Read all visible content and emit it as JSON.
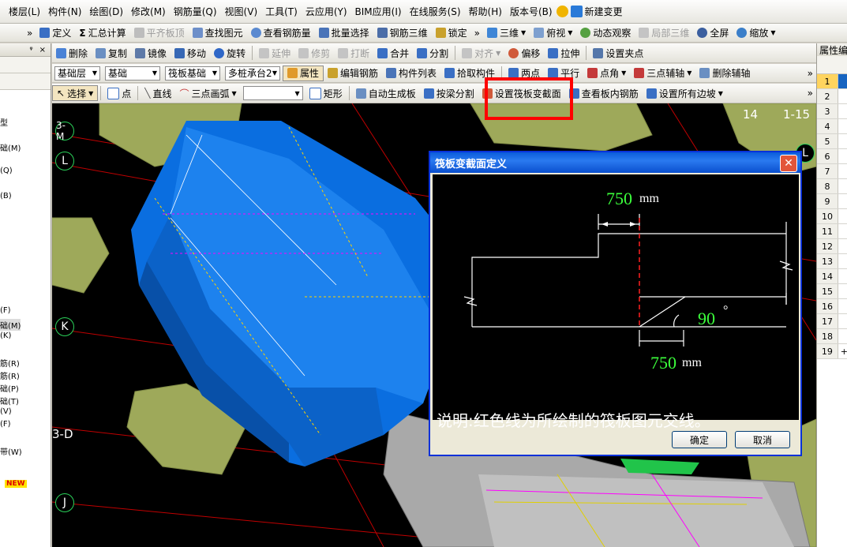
{
  "menu": [
    "楼层(L)",
    "构件(N)",
    "绘图(D)",
    "修改(M)",
    "钢筋量(Q)",
    "视图(V)",
    "工具(T)",
    "云应用(Y)",
    "BIM应用(I)",
    "在线服务(S)",
    "帮助(H)",
    "版本号(B)",
    "新建变更"
  ],
  "toolbar1": {
    "define": "定义",
    "sum": "汇总计算",
    "flush": "平齐板顶",
    "find": "查找图元",
    "view_rebar": "查看钢筋量",
    "batch_select": "批量选择",
    "rebar_3d": "钢筋三维",
    "lock": "锁定",
    "three_d": "三维",
    "top_view": "俯视",
    "dynamic": "动态观察",
    "partial_3d": "局部三维",
    "fullscreen": "全屏",
    "zoom": "缩放"
  },
  "toolbar2": {
    "delete": "删除",
    "copy": "复制",
    "mirror": "镜像",
    "move": "移动",
    "rotate": "旋转",
    "extend": "延伸",
    "trim": "修剪",
    "break": "打断",
    "merge": "合并",
    "split": "分割",
    "align": "对齐",
    "offset": "偏移",
    "stretch": "拉伸",
    "set_grip": "设置夹点"
  },
  "toolbar3": {
    "layer": "基础层",
    "category": "基础",
    "type": "筏板基础",
    "member": "多桩承台2",
    "property": "属性",
    "edit_rebar": "编辑钢筋",
    "member_list": "构件列表",
    "pick": "拾取构件",
    "two_points": "两点",
    "parallel": "平行",
    "point_angle": "点角",
    "three_point_aux": "三点辅轴",
    "delete_aux": "删除辅轴"
  },
  "toolbar4": {
    "select": "选择",
    "point": "点",
    "line": "直线",
    "arc": "三点画弧",
    "rect": "矩形",
    "auto_gen": "自动生成板",
    "split_by_beam": "按梁分割",
    "set_variable": "设置筏板变截面",
    "view_rebar_in_slab": "查看板内钢筋",
    "set_all_slope": "设置所有边坡"
  },
  "left_panel": {
    "items": [
      "型",
      "础(M)",
      "(Q)",
      "(B)",
      "(F)",
      "础(M)",
      "(K)",
      "筋(R)",
      "筋(R)",
      "础(P)",
      "础(T)",
      "(V)",
      "(F)",
      "带(W)",
      "NEW"
    ]
  },
  "right_panel": {
    "title": "属性编",
    "rows": [
      "1",
      "2",
      "3",
      "4",
      "5",
      "6",
      "7",
      "8",
      "9",
      "10",
      "11",
      "12",
      "13",
      "14",
      "15",
      "16",
      "17",
      "18",
      "19"
    ]
  },
  "viewport": {
    "axes": [
      "3-M",
      "L",
      "K",
      "3-D",
      "J",
      "14",
      "1-15",
      "L"
    ]
  },
  "dialog": {
    "title": "筏板变截面定义",
    "dim_top": "750",
    "dim_bottom": "750",
    "unit": "mm",
    "angle": "90",
    "degree": "°",
    "note": "说明:红色线为所绘制的筏板图元交线。",
    "ok": "确定",
    "cancel": "取消"
  },
  "colors": {
    "accent": "#0a5cdb",
    "highlight": "#ff0000",
    "slab": "#0a6ee0",
    "cap": "#9ea95a",
    "dim": "#3cff3c"
  }
}
